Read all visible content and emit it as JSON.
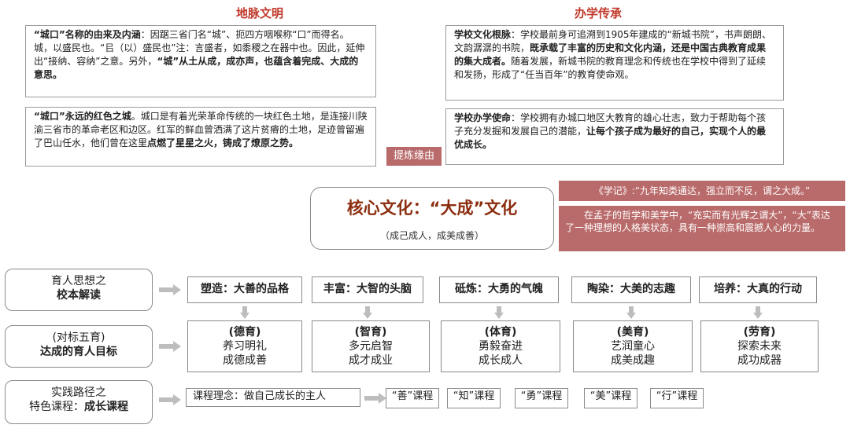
{
  "titles": {
    "left": "地脉文明",
    "right": "办学传承"
  },
  "boxes": {
    "b1": {
      "lead": "“城口”名称的由来及内涵",
      "text1": "：因踞三省门名“城”、扼四方咽喉称“口”而得名。城，以盛民也。“㠯（以）盛民也”注：言盛者，如黍稷之在器中也。因此，延伸出“接纳、容纳”之意。另外，",
      "bold": "“城”从土从成，成亦声，也蕴含着完成、大成的意思。"
    },
    "b2": {
      "lead": "“城口”永远的红色之城",
      "text1": "。城口是有着光荣革命传统的一块红色土地，是连接川陕渝三省市的革命老区和边区。红军的鲜血曾洒满了这片贫瘠的土地，足迹曾留遍了巴山任水，他们曾在这里",
      "bold": "点燃了星星之火，铸成了燎原之势。"
    },
    "b3": {
      "lead": "学校文化根脉",
      "text1": "：学校最前身可追溯到1905年建成的“新城书院”，书声朗朗、文韵潺潺的书院，",
      "bold": "既承载了丰富的历史和文化内涵，还是中国古典教育成果的集大成者。",
      "text2": "随着发展，新城书院的教育理念和传统也在学校中得到了延续和发扬，形成了“任当百年”的教育使命观。"
    },
    "b4": {
      "lead": "学校办学使命",
      "text1": "：学校拥有办城口地区大教育的雄心壮志，致力于帮助每个孩子充分发掘和发展自己的潜能，",
      "bold": "让每个孩子成为最好的自己，实现个人的最优成长。"
    }
  },
  "tag": "提炼缘由",
  "core": {
    "title": "核心文化：“大成”文化",
    "subtitle": "（成己成人，成美成善）"
  },
  "quotes": {
    "q1": "《学记》:“九年知类通达，强立而不反，谓之大成。”",
    "q2": "在孟子的哲学和美学中，“充实而有光辉之谓大”，“大”表达了一种理想的人格美状态，具有一种崇高和震撼人心的力量。"
  },
  "left_labels": [
    {
      "line1": "育人思想之",
      "line2": "校本解读"
    },
    {
      "line1": "(对标五育)",
      "line2": "达成的育人目标"
    },
    {
      "line1": "实践路径之",
      "line2a": "特色课程：",
      "line2b": "成长课程"
    }
  ],
  "row1": [
    "塑造：大善的品格",
    "丰富：大智的头脑",
    "砥炼：大勇的气魄",
    "陶染：大美的志趣",
    "培养：大真的行动"
  ],
  "row2": [
    {
      "title": "(德育)",
      "l1": "养习明礼",
      "l2": "成德成善"
    },
    {
      "title": "(智育)",
      "l1": "多元启智",
      "l2": "成才成业"
    },
    {
      "title": "(体育)",
      "l1": "勇毅奋进",
      "l2": "成长成人"
    },
    {
      "title": "(美育)",
      "l1": "艺润童心",
      "l2": "成美成趣"
    },
    {
      "title": "(劳育)",
      "l1": "探索未来",
      "l2": "成功成器"
    }
  ],
  "row3": {
    "concept": "课程理念：做自己成长的主人",
    "courses": [
      "“善”课程",
      "“知”课程",
      "“勇”课程",
      "“美”课程",
      "“行”课程"
    ]
  }
}
